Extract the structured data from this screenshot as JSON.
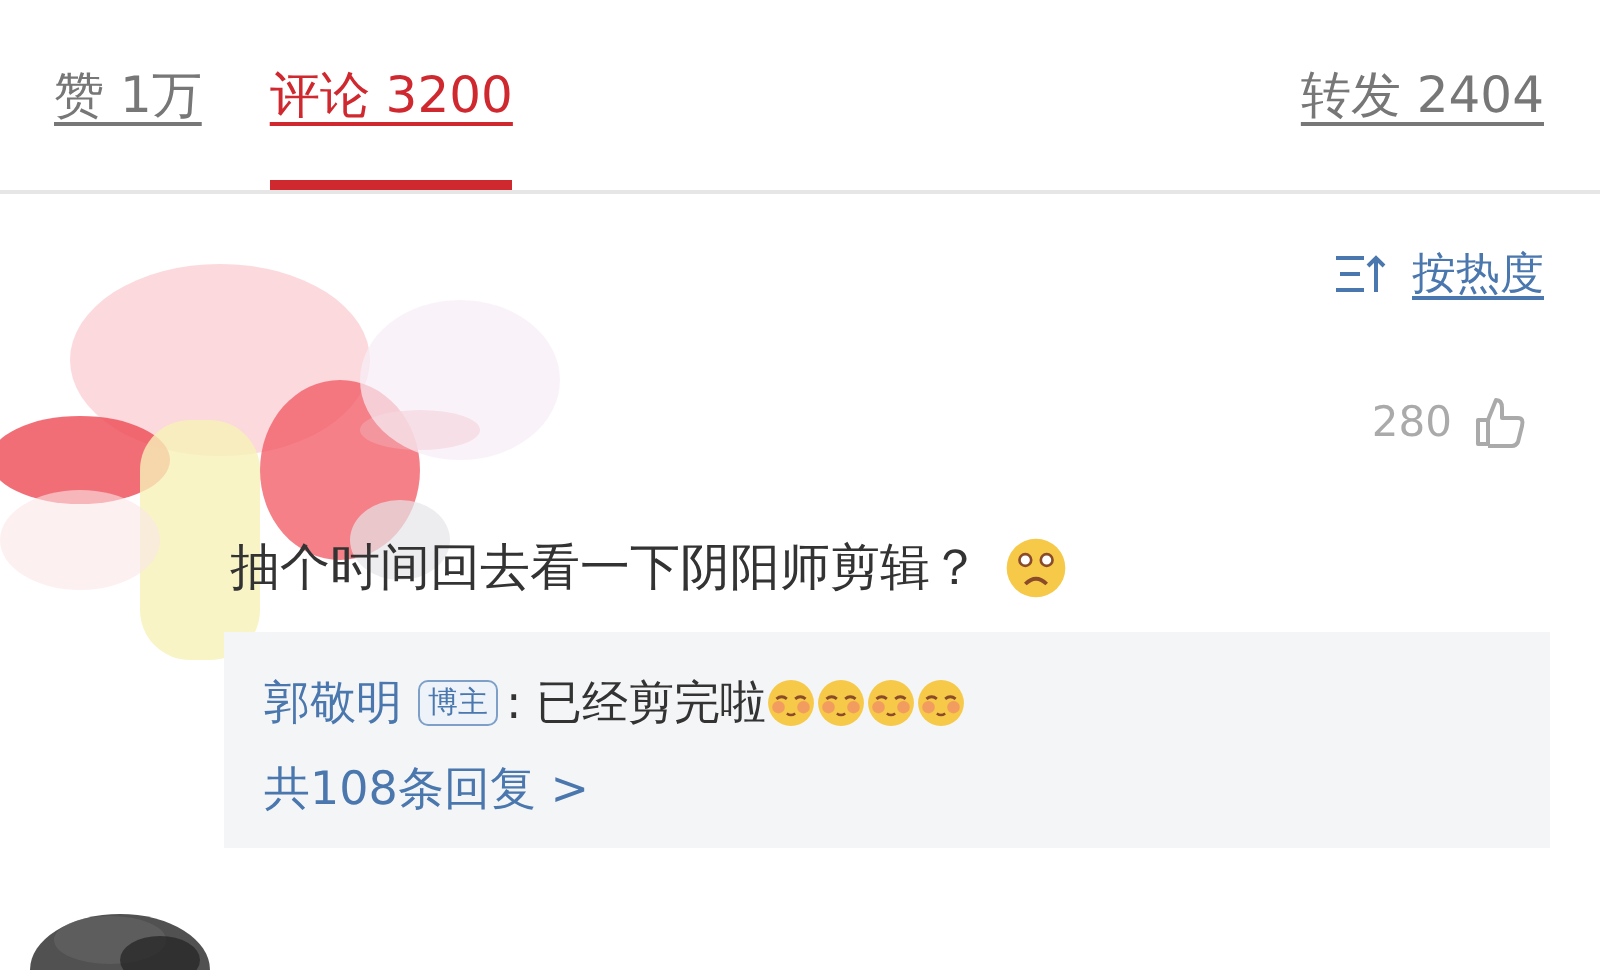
{
  "tabs": [
    {
      "label": "赞 1万",
      "selected": false
    },
    {
      "label": "评论 3200",
      "selected": true
    },
    {
      "label": "转发 2404",
      "selected": false
    }
  ],
  "sort": {
    "label": "按热度"
  },
  "comment": {
    "likes": "280",
    "text": "抽个时间回去看一下阴阳师剪辑？",
    "reply": {
      "author": "郭敬明",
      "badge": "博主",
      "text": ": 已经剪完啦",
      "more": "共108条回复 >"
    }
  }
}
